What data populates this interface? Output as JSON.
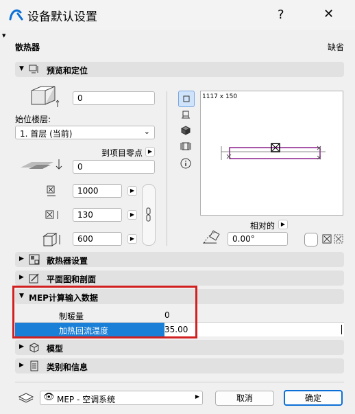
{
  "window": {
    "title": "设备默认设置",
    "help": "?",
    "close": "✕"
  },
  "header": {
    "object_name": "散热器",
    "mode": "缺省"
  },
  "sections": {
    "preview": "预览和定位",
    "radiator_settings": "散热器设置",
    "plan_section": "平面图和剖面",
    "mep_calc": "MEP计算输入数据",
    "model": "模型",
    "category": "类别和信息"
  },
  "preview": {
    "top_offset": "0",
    "home_story_label": "始位楼层:",
    "home_story_value": "1. 首层 (当前)",
    "to_project_zero": "到项目零点",
    "project_zero_value": "0",
    "width": "1000",
    "depth": "130",
    "height": "600",
    "preview_size": "1117 x 150",
    "relative_label": "相对的",
    "angle": "0.00°"
  },
  "mep_data": {
    "rows": [
      {
        "label": "制暖量",
        "value": "0"
      },
      {
        "label": "加热回流温度",
        "value": "35.00"
      }
    ]
  },
  "footer": {
    "layer": "MEP - 空调系统",
    "cancel": "取消",
    "ok": "确定"
  },
  "colors": {
    "accent": "#0a6fd6",
    "highlight_row": "#1a7fd6",
    "callout_border": "#d21f1f",
    "preview_shape": "#8b1f8b"
  }
}
